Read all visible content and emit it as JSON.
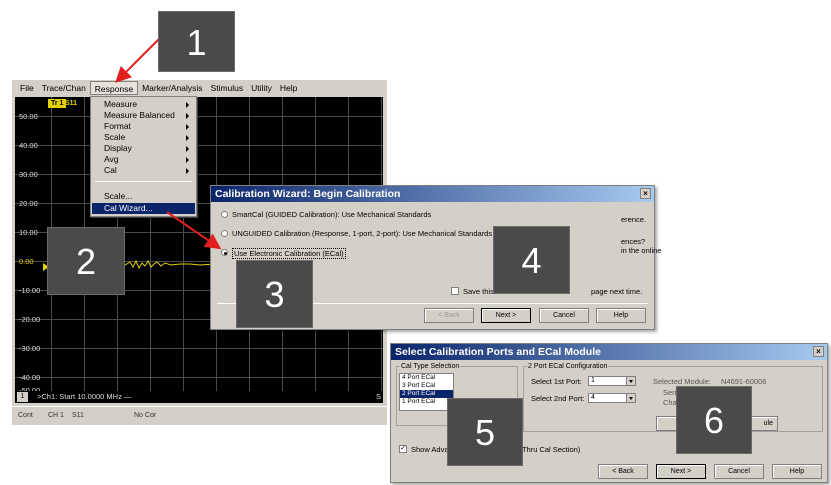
{
  "app": {
    "menu": [
      "File",
      "Trace/Chan",
      "Response",
      "Marker/Analysis",
      "Stimulus",
      "Utility",
      "Help"
    ],
    "trace_tag": "Tr 1",
    "trace_param": "S11",
    "y_labels": [
      "50.00",
      "40.00",
      "30.00",
      "20.00",
      "10.00",
      "0.00",
      "-10.00",
      "-20.00",
      "-30.00",
      "-40.00",
      "-50.00"
    ],
    "channel_number": "1",
    "start_text": ">Ch1: Start 10.0000 MHz —",
    "stop_text_fragment": "S",
    "status": {
      "mode": "Cont",
      "channel": "CH 1",
      "param": "S11",
      "correction": "No Cor"
    }
  },
  "response_menu": {
    "items": [
      {
        "label": "Measure",
        "submenu": true
      },
      {
        "label": "Measure Balanced",
        "submenu": true
      },
      {
        "label": "Format",
        "submenu": true
      },
      {
        "label": "Scale",
        "submenu": true
      },
      {
        "label": "Display",
        "submenu": true
      },
      {
        "label": "Avg",
        "submenu": true
      },
      {
        "label": "Cal",
        "submenu": true
      },
      {
        "label": "Scale...",
        "submenu": false
      },
      {
        "label": "Cal Wizard...",
        "submenu": false,
        "selected": true
      }
    ]
  },
  "wizard": {
    "title": "Calibration Wizard: Begin Calibration",
    "close": "×",
    "options": [
      "SmartCal (GUIDED Calibration): Use Mechanical Standards",
      "UNGUIDED Calibration (Response, 1-port, 2-port): Use Mechanical Standards",
      "Use Electronic Calibration (ECal)"
    ],
    "selected_option": 2,
    "help_fragments": [
      "erence.",
      "ences?",
      "in the online"
    ],
    "save_checkbox_label": "Save this",
    "save_checkbox_tail": "page next time.",
    "buttons": {
      "back": "< Back",
      "next": "Next >",
      "cancel": "Cancel",
      "help": "Help"
    }
  },
  "ports_dialog": {
    "title": "Select Calibration Ports and ECal Module",
    "close": "×",
    "cal_type_label": "Cal Type Selection",
    "cal_types": [
      "4 Port ECal",
      "3 Port ECal",
      "2 Port ECal",
      "1 Port ECal"
    ],
    "selected_cal_type": 2,
    "config_label": "2 Port ECal Configuration",
    "first_port_label": "Select 1st Port:",
    "first_port_value": "1",
    "second_port_label": "Select 2nd Port:",
    "second_port_value": "4",
    "module_fragments": [
      "Selected Module:",
      "N4691-60006",
      "Serial",
      "Chara"
    ],
    "module_button_tail": "ule",
    "show_advanced_label": "Show Adva",
    "show_advanced_checked": true,
    "thru_fragment": "& Thru Cal Section)",
    "buttons": {
      "back": "< Back",
      "next": "Next >",
      "cancel": "Cancel",
      "help": "Help"
    }
  },
  "steps": [
    "1",
    "2",
    "3",
    "4",
    "5",
    "6"
  ],
  "colors": {
    "title_active": "#0a246a",
    "title_gradient_end": "#a6caf0",
    "trace": "#e6d100",
    "arrow": "#e01e1e",
    "badge": "#4a4a4a"
  }
}
